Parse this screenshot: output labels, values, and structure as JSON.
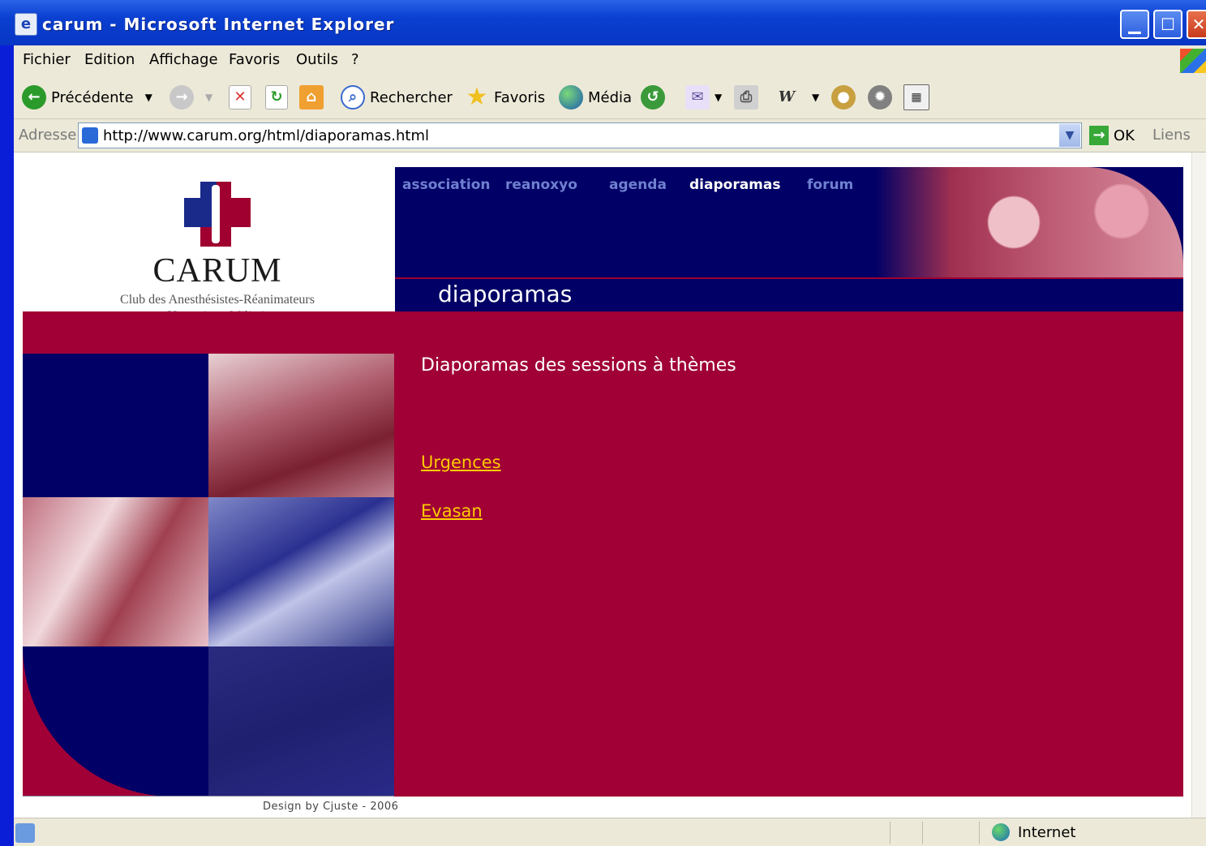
{
  "window": {
    "title": "carum - Microsoft Internet Explorer",
    "app_icon": "ie-icon",
    "controls": {
      "minimize": "▁",
      "maximize": "☐",
      "close": "✕"
    }
  },
  "menu": [
    "Fichier",
    "Edition",
    "Affichage",
    "Favoris",
    "Outils",
    "?"
  ],
  "toolbar": {
    "back": "Précédente",
    "search": "Rechercher",
    "favorites": "Favoris",
    "media": "Média"
  },
  "address": {
    "label": "Adresse",
    "url": "http://www.carum.org/html/diaporamas.html",
    "go": "OK",
    "links": "Liens"
  },
  "site": {
    "logo_title": "CARUM",
    "logo_subtitle_1": "Club des Anesthésistes-Réanimateurs",
    "logo_subtitle_2": "et Urgentistes Militaires",
    "nav": [
      "association",
      "reanoxyo",
      "agenda",
      "diaporamas",
      "forum"
    ],
    "active_nav": "diaporamas",
    "page_title": "diaporamas",
    "heading": "Diaporamas des sessions à thèmes",
    "links": [
      "Urgences",
      "Evasan"
    ],
    "footer": "Design by Cjuste - 2006"
  },
  "status": {
    "zone": "Internet"
  },
  "colors": {
    "navy": "#000066",
    "crimson": "#a00036",
    "link": "#ffcc00"
  }
}
